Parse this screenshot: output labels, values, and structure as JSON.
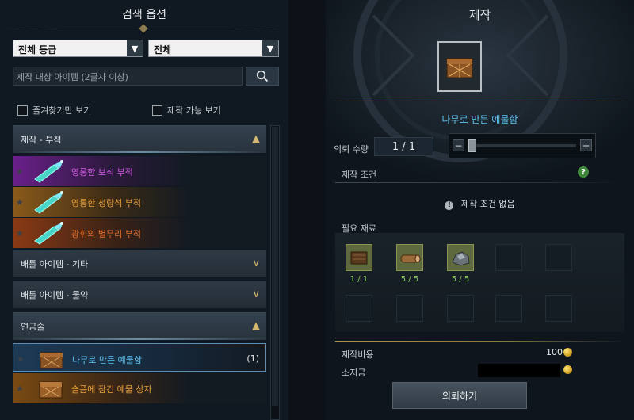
{
  "left": {
    "title": "검색 옵션",
    "grade_select": "전체 등급",
    "type_select": "전체",
    "search_placeholder": "제작 대상 아이템 (2글자 이상)",
    "favorites_label": "즐겨찾기만 보기",
    "craftable_label": "제작 가능 보기",
    "categories": [
      {
        "label": "제작 - 부적",
        "expanded": true,
        "items": [
          {
            "name": "영롱한 보석 부적",
            "color": "#d65ee8"
          },
          {
            "name": "영롱한 청량석 부적",
            "color": "#e8a03c"
          },
          {
            "name": "광휘의 별무리 부적",
            "color": "#e8702c"
          }
        ]
      },
      {
        "label": "배틀 아이템 - 기타",
        "expanded": false
      },
      {
        "label": "배틀 아이템 - 물약",
        "expanded": false
      },
      {
        "label": "연금술",
        "expanded": true,
        "items": [
          {
            "name": "나무로 만든 예물함",
            "count": "(1)",
            "color": "#5fc3f0",
            "selected": true
          },
          {
            "name": "슬픔에 잠긴 예물 상자",
            "color": "#e8a03c"
          }
        ]
      }
    ]
  },
  "right": {
    "title": "제작",
    "item_name": "나무로 만든 예물함",
    "quantity_label": "의뢰 수량",
    "quantity_value": "1 / 1",
    "slider_level": 0,
    "condition_title": "제작 조건",
    "no_condition_text": "제작 조건 없음",
    "materials_title": "필요 재료",
    "materials": [
      {
        "icon": "wood-log-icon",
        "count": "1 / 1"
      },
      {
        "icon": "timber-icon",
        "count": "5 / 5"
      },
      {
        "icon": "ore-stone-icon",
        "count": "5 / 5"
      }
    ],
    "cost_label": "제작비용",
    "cost_value": "100",
    "held_label": "소지금",
    "request_button": "의뢰하기"
  },
  "colors": {
    "accent_blue": "#5fc3f0",
    "gold": "#d4b770",
    "material_ok": "#8ed060"
  }
}
